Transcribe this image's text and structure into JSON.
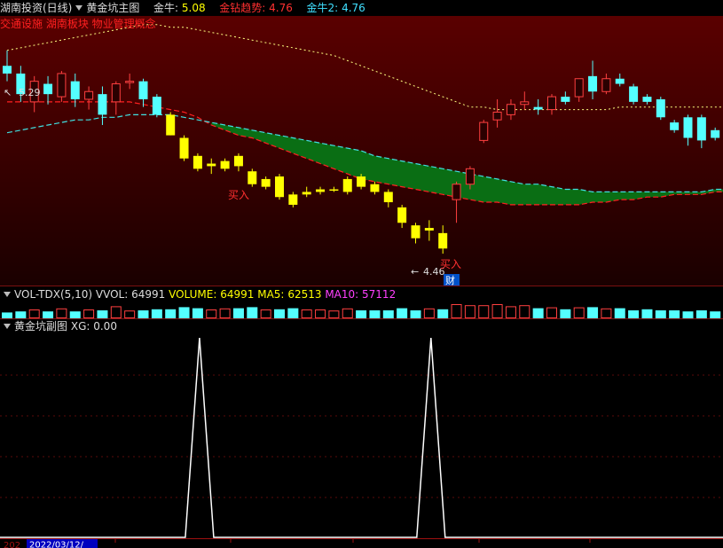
{
  "main_header": {
    "stock_label": "湖南投资(日线)",
    "indicator_name": "黄金坑主图",
    "items": [
      {
        "label": "金牛:",
        "value": "5.08",
        "color": "#ffff00"
      },
      {
        "label": "金钻趋势:",
        "value": "4.76",
        "color": "#ff3030"
      },
      {
        "label": "金牛2:",
        "value": "4.76",
        "color": "#40e0ff"
      }
    ]
  },
  "concept_tags": "交通设施 湖南板块 物业管理概念",
  "annotations": {
    "high_label": "5.29",
    "low_label": "4.46",
    "buy_label_1": "买入",
    "buy_label_2": "买入",
    "cai_label": "财"
  },
  "vol_header": {
    "name": "VOL-TDX(5,10)",
    "items": [
      {
        "label": "VVOL:",
        "value": "64991",
        "color": "#dddddd"
      },
      {
        "label": "VOLUME:",
        "value": "64991",
        "color": "#ffff00"
      },
      {
        "label": "MA5:",
        "value": "62513",
        "color": "#ffff00"
      },
      {
        "label": "MA10:",
        "value": "57112",
        "color": "#ff40ff"
      }
    ]
  },
  "sub_header": {
    "name": "黄金坑副图",
    "items": [
      {
        "label": "XG:",
        "value": "0.00",
        "color": "#dddddd"
      }
    ]
  },
  "bottom_axis": {
    "left_label": "202",
    "date_box": "2022/03/12/"
  },
  "colors": {
    "up": "#ff4040",
    "down": "#54ffff",
    "yellow": "#ffff00",
    "ma_red": "#ff2020",
    "ma_cyan": "#40e0e0",
    "ribbon_green": "#0a6e14",
    "trend_dot": "#ffff80"
  },
  "chart_data": {
    "type": "candlestick",
    "price_range": [
      4.4,
      5.42
    ],
    "candles": [
      {
        "o": 5.24,
        "h": 5.3,
        "l": 5.18,
        "c": 5.21,
        "up": false,
        "yellow": false
      },
      {
        "o": 5.21,
        "h": 5.24,
        "l": 5.1,
        "c": 5.13,
        "up": false,
        "yellow": false
      },
      {
        "o": 5.1,
        "h": 5.2,
        "l": 5.06,
        "c": 5.18,
        "up": true,
        "yellow": false
      },
      {
        "o": 5.17,
        "h": 5.2,
        "l": 5.09,
        "c": 5.13,
        "up": false,
        "yellow": false
      },
      {
        "o": 5.12,
        "h": 5.22,
        "l": 5.1,
        "c": 5.21,
        "up": true,
        "yellow": false
      },
      {
        "o": 5.18,
        "h": 5.21,
        "l": 5.08,
        "c": 5.11,
        "up": false,
        "yellow": false
      },
      {
        "o": 5.11,
        "h": 5.16,
        "l": 5.07,
        "c": 5.14,
        "up": true,
        "yellow": false
      },
      {
        "o": 5.13,
        "h": 5.16,
        "l": 5.01,
        "c": 5.05,
        "up": false,
        "yellow": false
      },
      {
        "o": 5.1,
        "h": 5.18,
        "l": 5.05,
        "c": 5.17,
        "up": true,
        "yellow": false
      },
      {
        "o": 5.18,
        "h": 5.21,
        "l": 5.15,
        "c": 5.18,
        "up": true,
        "yellow": false
      },
      {
        "o": 5.18,
        "h": 5.19,
        "l": 5.08,
        "c": 5.11,
        "up": false,
        "yellow": false
      },
      {
        "o": 5.12,
        "h": 5.13,
        "l": 5.04,
        "c": 5.05,
        "up": false,
        "yellow": false
      },
      {
        "o": 5.05,
        "h": 5.06,
        "l": 4.97,
        "c": 4.97,
        "up": false,
        "yellow": true
      },
      {
        "o": 4.96,
        "h": 4.97,
        "l": 4.87,
        "c": 4.88,
        "up": false,
        "yellow": true
      },
      {
        "o": 4.89,
        "h": 4.9,
        "l": 4.83,
        "c": 4.84,
        "up": false,
        "yellow": true
      },
      {
        "o": 4.85,
        "h": 4.88,
        "l": 4.82,
        "c": 4.86,
        "up": true,
        "yellow": true
      },
      {
        "o": 4.84,
        "h": 4.88,
        "l": 4.83,
        "c": 4.87,
        "up": true,
        "yellow": true
      },
      {
        "o": 4.89,
        "h": 4.9,
        "l": 4.83,
        "c": 4.85,
        "up": false,
        "yellow": true
      },
      {
        "o": 4.83,
        "h": 4.84,
        "l": 4.77,
        "c": 4.78,
        "up": false,
        "yellow": true
      },
      {
        "o": 4.77,
        "h": 4.81,
        "l": 4.76,
        "c": 4.8,
        "up": true,
        "yellow": true
      },
      {
        "o": 4.81,
        "h": 4.82,
        "l": 4.72,
        "c": 4.73,
        "up": false,
        "yellow": true
      },
      {
        "o": 4.74,
        "h": 4.75,
        "l": 4.69,
        "c": 4.7,
        "up": false,
        "yellow": true
      },
      {
        "o": 4.74,
        "h": 4.77,
        "l": 4.73,
        "c": 4.75,
        "up": true,
        "yellow": true
      },
      {
        "o": 4.75,
        "h": 4.77,
        "l": 4.74,
        "c": 4.76,
        "up": true,
        "yellow": true
      },
      {
        "o": 4.76,
        "h": 4.77,
        "l": 4.75,
        "c": 4.76,
        "up": true,
        "yellow": true
      },
      {
        "o": 4.75,
        "h": 4.81,
        "l": 4.74,
        "c": 4.8,
        "up": true,
        "yellow": true
      },
      {
        "o": 4.81,
        "h": 4.82,
        "l": 4.76,
        "c": 4.77,
        "up": false,
        "yellow": true
      },
      {
        "o": 4.78,
        "h": 4.79,
        "l": 4.74,
        "c": 4.75,
        "up": false,
        "yellow": true
      },
      {
        "o": 4.75,
        "h": 4.76,
        "l": 4.69,
        "c": 4.71,
        "up": false,
        "yellow": true
      },
      {
        "o": 4.69,
        "h": 4.7,
        "l": 4.61,
        "c": 4.63,
        "up": false,
        "yellow": true
      },
      {
        "o": 4.62,
        "h": 4.63,
        "l": 4.55,
        "c": 4.57,
        "up": false,
        "yellow": true
      },
      {
        "o": 4.6,
        "h": 4.64,
        "l": 4.56,
        "c": 4.61,
        "up": true,
        "yellow": true
      },
      {
        "o": 4.59,
        "h": 4.62,
        "l": 4.51,
        "c": 4.53,
        "up": false,
        "yellow": true
      },
      {
        "o": 4.72,
        "h": 4.79,
        "l": 4.63,
        "c": 4.78,
        "up": true,
        "yellow": false
      },
      {
        "o": 4.78,
        "h": 4.85,
        "l": 4.76,
        "c": 4.84,
        "up": true,
        "yellow": false
      },
      {
        "o": 4.95,
        "h": 5.03,
        "l": 4.94,
        "c": 5.02,
        "up": true,
        "yellow": false
      },
      {
        "o": 5.03,
        "h": 5.11,
        "l": 5.0,
        "c": 5.06,
        "up": true,
        "yellow": false
      },
      {
        "o": 5.05,
        "h": 5.11,
        "l": 5.03,
        "c": 5.09,
        "up": true,
        "yellow": false
      },
      {
        "o": 5.09,
        "h": 5.14,
        "l": 5.07,
        "c": 5.1,
        "up": true,
        "yellow": false
      },
      {
        "o": 5.08,
        "h": 5.11,
        "l": 5.05,
        "c": 5.07,
        "up": false,
        "yellow": false
      },
      {
        "o": 5.07,
        "h": 5.13,
        "l": 5.05,
        "c": 5.12,
        "up": true,
        "yellow": false
      },
      {
        "o": 5.12,
        "h": 5.14,
        "l": 5.09,
        "c": 5.1,
        "up": false,
        "yellow": false
      },
      {
        "o": 5.12,
        "h": 5.19,
        "l": 5.1,
        "c": 5.19,
        "up": true,
        "yellow": false
      },
      {
        "o": 5.2,
        "h": 5.26,
        "l": 5.11,
        "c": 5.14,
        "up": false,
        "yellow": false
      },
      {
        "o": 5.14,
        "h": 5.21,
        "l": 5.13,
        "c": 5.19,
        "up": true,
        "yellow": false
      },
      {
        "o": 5.19,
        "h": 5.21,
        "l": 5.16,
        "c": 5.17,
        "up": false,
        "yellow": false
      },
      {
        "o": 5.16,
        "h": 5.17,
        "l": 5.09,
        "c": 5.1,
        "up": false,
        "yellow": false
      },
      {
        "o": 5.12,
        "h": 5.13,
        "l": 5.09,
        "c": 5.1,
        "up": false,
        "yellow": false
      },
      {
        "o": 5.11,
        "h": 5.12,
        "l": 5.03,
        "c": 5.04,
        "up": false,
        "yellow": false
      },
      {
        "o": 5.02,
        "h": 5.03,
        "l": 4.98,
        "c": 4.99,
        "up": false,
        "yellow": false
      },
      {
        "o": 5.04,
        "h": 5.05,
        "l": 4.93,
        "c": 4.96,
        "up": false,
        "yellow": false
      },
      {
        "o": 5.04,
        "h": 5.05,
        "l": 4.92,
        "c": 4.95,
        "up": false,
        "yellow": false
      },
      {
        "o": 4.99,
        "h": 5.0,
        "l": 4.95,
        "c": 4.96,
        "up": false,
        "yellow": false
      },
      {
        "o": 4.96,
        "h": 4.98,
        "l": 4.91,
        "c": 4.95,
        "up": true,
        "yellow": false
      }
    ],
    "ma_red": [
      5.1,
      5.1,
      5.1,
      5.1,
      5.1,
      5.1,
      5.1,
      5.1,
      5.1,
      5.1,
      5.09,
      5.08,
      5.07,
      5.06,
      5.04,
      5.01,
      4.99,
      4.97,
      4.96,
      4.94,
      4.92,
      4.9,
      4.88,
      4.86,
      4.84,
      4.82,
      4.8,
      4.79,
      4.78,
      4.77,
      4.76,
      4.75,
      4.74,
      4.73,
      4.72,
      4.71,
      4.71,
      4.7,
      4.7,
      4.7,
      4.7,
      4.7,
      4.7,
      4.71,
      4.71,
      4.72,
      4.72,
      4.73,
      4.73,
      4.74,
      4.74,
      4.74,
      4.75,
      4.75
    ],
    "ma_cyan": [
      4.98,
      4.99,
      5.0,
      5.01,
      5.02,
      5.03,
      5.03,
      5.04,
      5.04,
      5.05,
      5.05,
      5.05,
      5.05,
      5.04,
      5.03,
      5.02,
      5.01,
      5.0,
      4.99,
      4.98,
      4.97,
      4.96,
      4.95,
      4.94,
      4.93,
      4.92,
      4.91,
      4.89,
      4.88,
      4.87,
      4.86,
      4.85,
      4.84,
      4.83,
      4.82,
      4.81,
      4.8,
      4.79,
      4.78,
      4.78,
      4.77,
      4.76,
      4.76,
      4.75,
      4.75,
      4.75,
      4.75,
      4.75,
      4.75,
      4.75,
      4.75,
      4.75,
      4.76,
      4.76
    ],
    "trend_dots": [
      5.3,
      5.31,
      5.32,
      5.33,
      5.34,
      5.35,
      5.36,
      5.37,
      5.38,
      5.39,
      5.4,
      5.4,
      5.39,
      5.39,
      5.38,
      5.37,
      5.36,
      5.35,
      5.34,
      5.33,
      5.32,
      5.31,
      5.3,
      5.29,
      5.28,
      5.26,
      5.24,
      5.22,
      5.2,
      5.18,
      5.16,
      5.14,
      5.12,
      5.1,
      5.08,
      5.08,
      5.07,
      5.07,
      5.07,
      5.07,
      5.07,
      5.07,
      5.07,
      5.07,
      5.07,
      5.08,
      5.08,
      5.08,
      5.08,
      5.08,
      5.08,
      5.08,
      5.08,
      5.08
    ],
    "volume": [
      0.3,
      0.4,
      0.5,
      0.4,
      0.6,
      0.4,
      0.5,
      0.5,
      0.8,
      0.4,
      0.5,
      0.6,
      0.6,
      0.8,
      0.7,
      0.5,
      0.6,
      0.7,
      0.8,
      0.5,
      0.6,
      0.7,
      0.5,
      0.5,
      0.4,
      0.6,
      0.5,
      0.5,
      0.5,
      0.7,
      0.5,
      0.6,
      0.6,
      1.0,
      0.9,
      0.9,
      1.0,
      0.8,
      0.9,
      0.7,
      0.7,
      0.6,
      0.7,
      0.8,
      0.6,
      0.7,
      0.5,
      0.6,
      0.5,
      0.5,
      0.4,
      0.5,
      0.4,
      0.4
    ],
    "xg_spikes": [
      14,
      31
    ],
    "xg_range": [
      0,
      1
    ]
  }
}
